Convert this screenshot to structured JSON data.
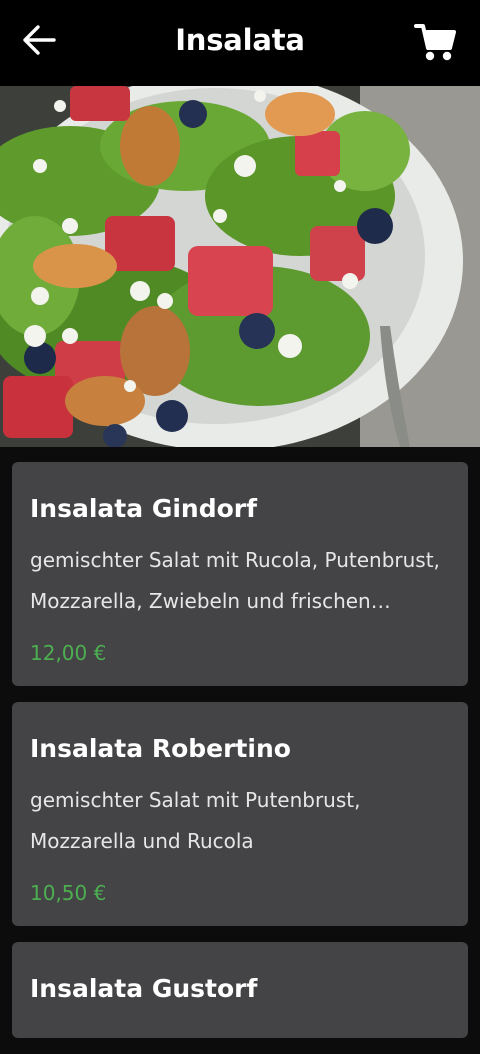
{
  "header": {
    "title": "Insalata",
    "back_icon": "arrow-left-icon",
    "cart_icon": "shopping-cart-icon"
  },
  "hero": {
    "image_subject": "salad-photo"
  },
  "colors": {
    "price": "#4caf50",
    "card_bg": "#444446",
    "appbar_bg": "#000000"
  },
  "items": [
    {
      "name": "Insalata Gindorf",
      "description": "gemischter Salat mit Rucola, Putenbrust, Mozzarella, Zwiebeln und frischen Paprika",
      "price": "12,00 €"
    },
    {
      "name": "Insalata Robertino",
      "description": "gemischter Salat mit Putenbrust, Mozzarella und Rucola",
      "price": "10,50 €"
    },
    {
      "name": "Insalata Gustorf",
      "description": "",
      "price": ""
    }
  ]
}
